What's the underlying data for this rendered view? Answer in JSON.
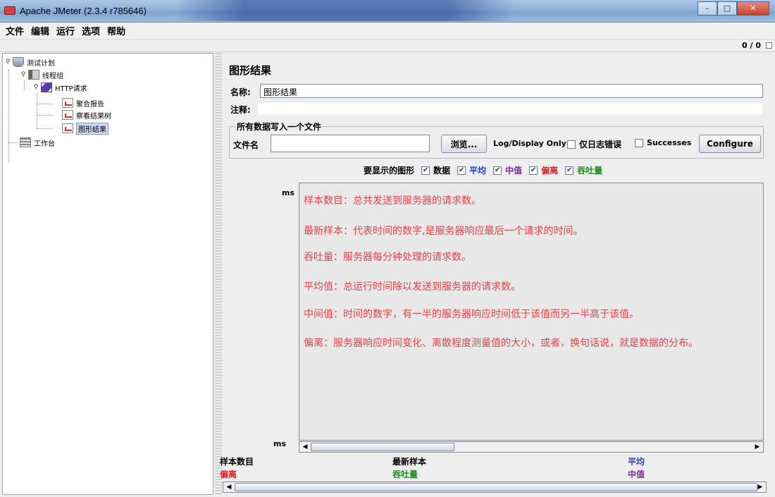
{
  "window": {
    "title": "Apache JMeter (2.3.4 r785646)",
    "btn_minimize": "–",
    "btn_maximize": "□",
    "btn_close": "✕"
  },
  "menu": [
    "文件",
    "编辑",
    "运行",
    "选项",
    "帮助"
  ],
  "toolbar": {
    "count": "0 / 0"
  },
  "tree": {
    "nodes": [
      {
        "label": "测试计划",
        "icon": "test-plan-icon"
      },
      {
        "label": "线程组",
        "icon": "thread-group-icon"
      },
      {
        "label": "HTTP请求",
        "icon": "http-sampler-icon"
      },
      {
        "label": "聚合报告",
        "icon": "report-icon"
      },
      {
        "label": "察看结果树",
        "icon": "report-icon"
      },
      {
        "label": "图形结果",
        "icon": "report-icon",
        "selected": true
      },
      {
        "label": "工作台",
        "icon": "workbench-icon"
      }
    ]
  },
  "main": {
    "title": "图形结果",
    "name_label": "名称:",
    "name_value": "图形结果",
    "comment_label": "注释:",
    "comment_value": "",
    "file_group_title": "所有数据写入一个文件",
    "file_label": "文件名",
    "file_value": "",
    "browse_label": "浏览...",
    "log_display_label": "Log/Display Only:",
    "errors_only_label": "仅日志错误",
    "successes_label": "Successes",
    "configure_label": "Configure",
    "graphs_label": "要显示的图形",
    "graph_options": [
      {
        "label": "数据",
        "color": "#000000",
        "checked": true
      },
      {
        "label": "平均",
        "color": "#1f3fd6",
        "checked": true
      },
      {
        "label": "中值",
        "color": "#7d2a9a",
        "checked": true
      },
      {
        "label": "偏离",
        "color": "#e02020",
        "checked": true
      },
      {
        "label": "吞吐量",
        "color": "#1f8a1f",
        "checked": true
      }
    ],
    "ms_label_top": "ms",
    "ms_label_bottom": "ms",
    "descriptions": [
      "样本数目：总共发送到服务器的请求数。",
      "最新样本：代表时间的数字,是服务器响应最后一个请求的时间。",
      "吞吐量：服务器每分钟处理的请求数。",
      "平均值：总运行时间除以发送到服务器的请求数。",
      "中间值：时间的数字，有一半的服务器响应时间低于该值而另一半高于该值。",
      "偏离：服务器响应时间变化、离散程度测量值的大小，或者，换句话说，就是数据的分布。"
    ],
    "description_color": "#e8414a",
    "legend": {
      "samples": "样本数目",
      "latest": "最新样本",
      "average": "平均",
      "deviation": "偏离",
      "throughput": "吞吐量",
      "median": "中值"
    },
    "legend_colors": {
      "samples": "#000000",
      "latest": "#000000",
      "average": "#1f3fd6",
      "deviation": "#e02020",
      "throughput": "#1f8a1f",
      "median": "#7d2a9a"
    }
  }
}
